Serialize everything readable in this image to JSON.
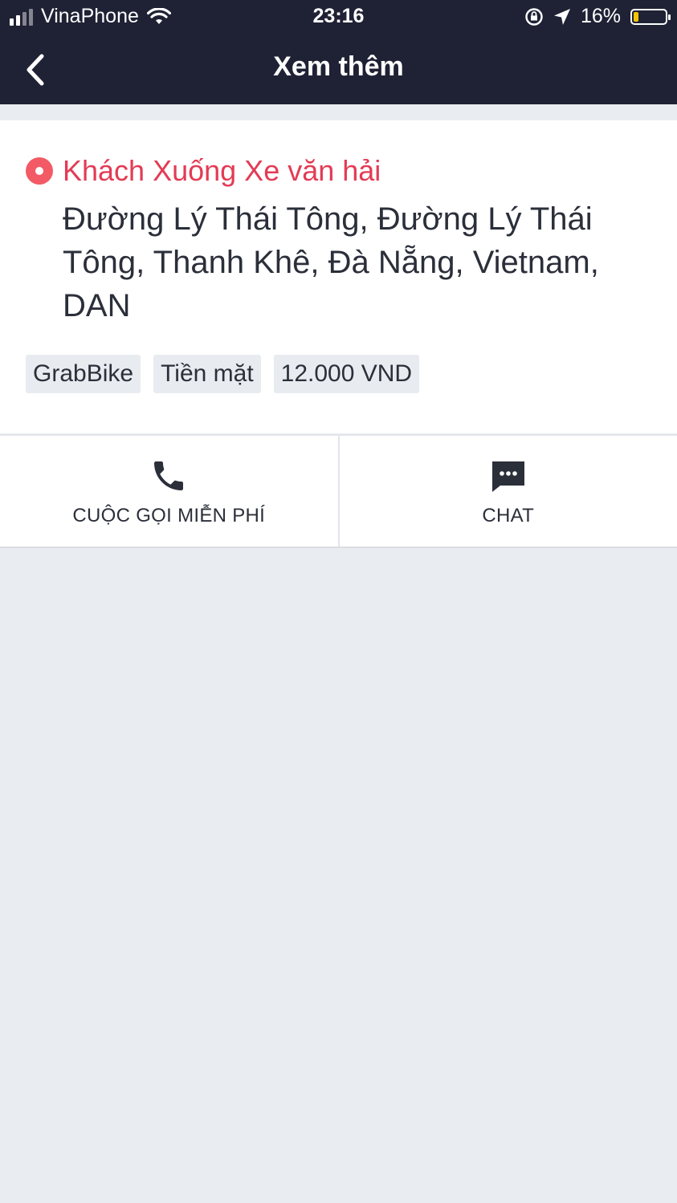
{
  "status_bar": {
    "carrier": "VinaPhone",
    "time": "23:16",
    "battery": "16%",
    "battery_level": 0.16
  },
  "nav": {
    "title": "Xem thêm",
    "back_icon": "chevron-left-icon"
  },
  "booking": {
    "passenger": "Khách Xuống Xe văn hải",
    "address": "Đường Lý Thái Tông, Đường Lý Thái Tông, Thanh Khê, Đà Nẵng, Vietnam, DAN",
    "chips": [
      "GrabBike",
      "Tiền mặt",
      "12.000 VND"
    ]
  },
  "actions": {
    "call_label": "CUỘC GỌI MIỄN PHÍ",
    "chat_label": "CHAT"
  },
  "colors": {
    "header": "#1f2235",
    "accent": "#e33b55",
    "background": "#e9ecf0"
  }
}
